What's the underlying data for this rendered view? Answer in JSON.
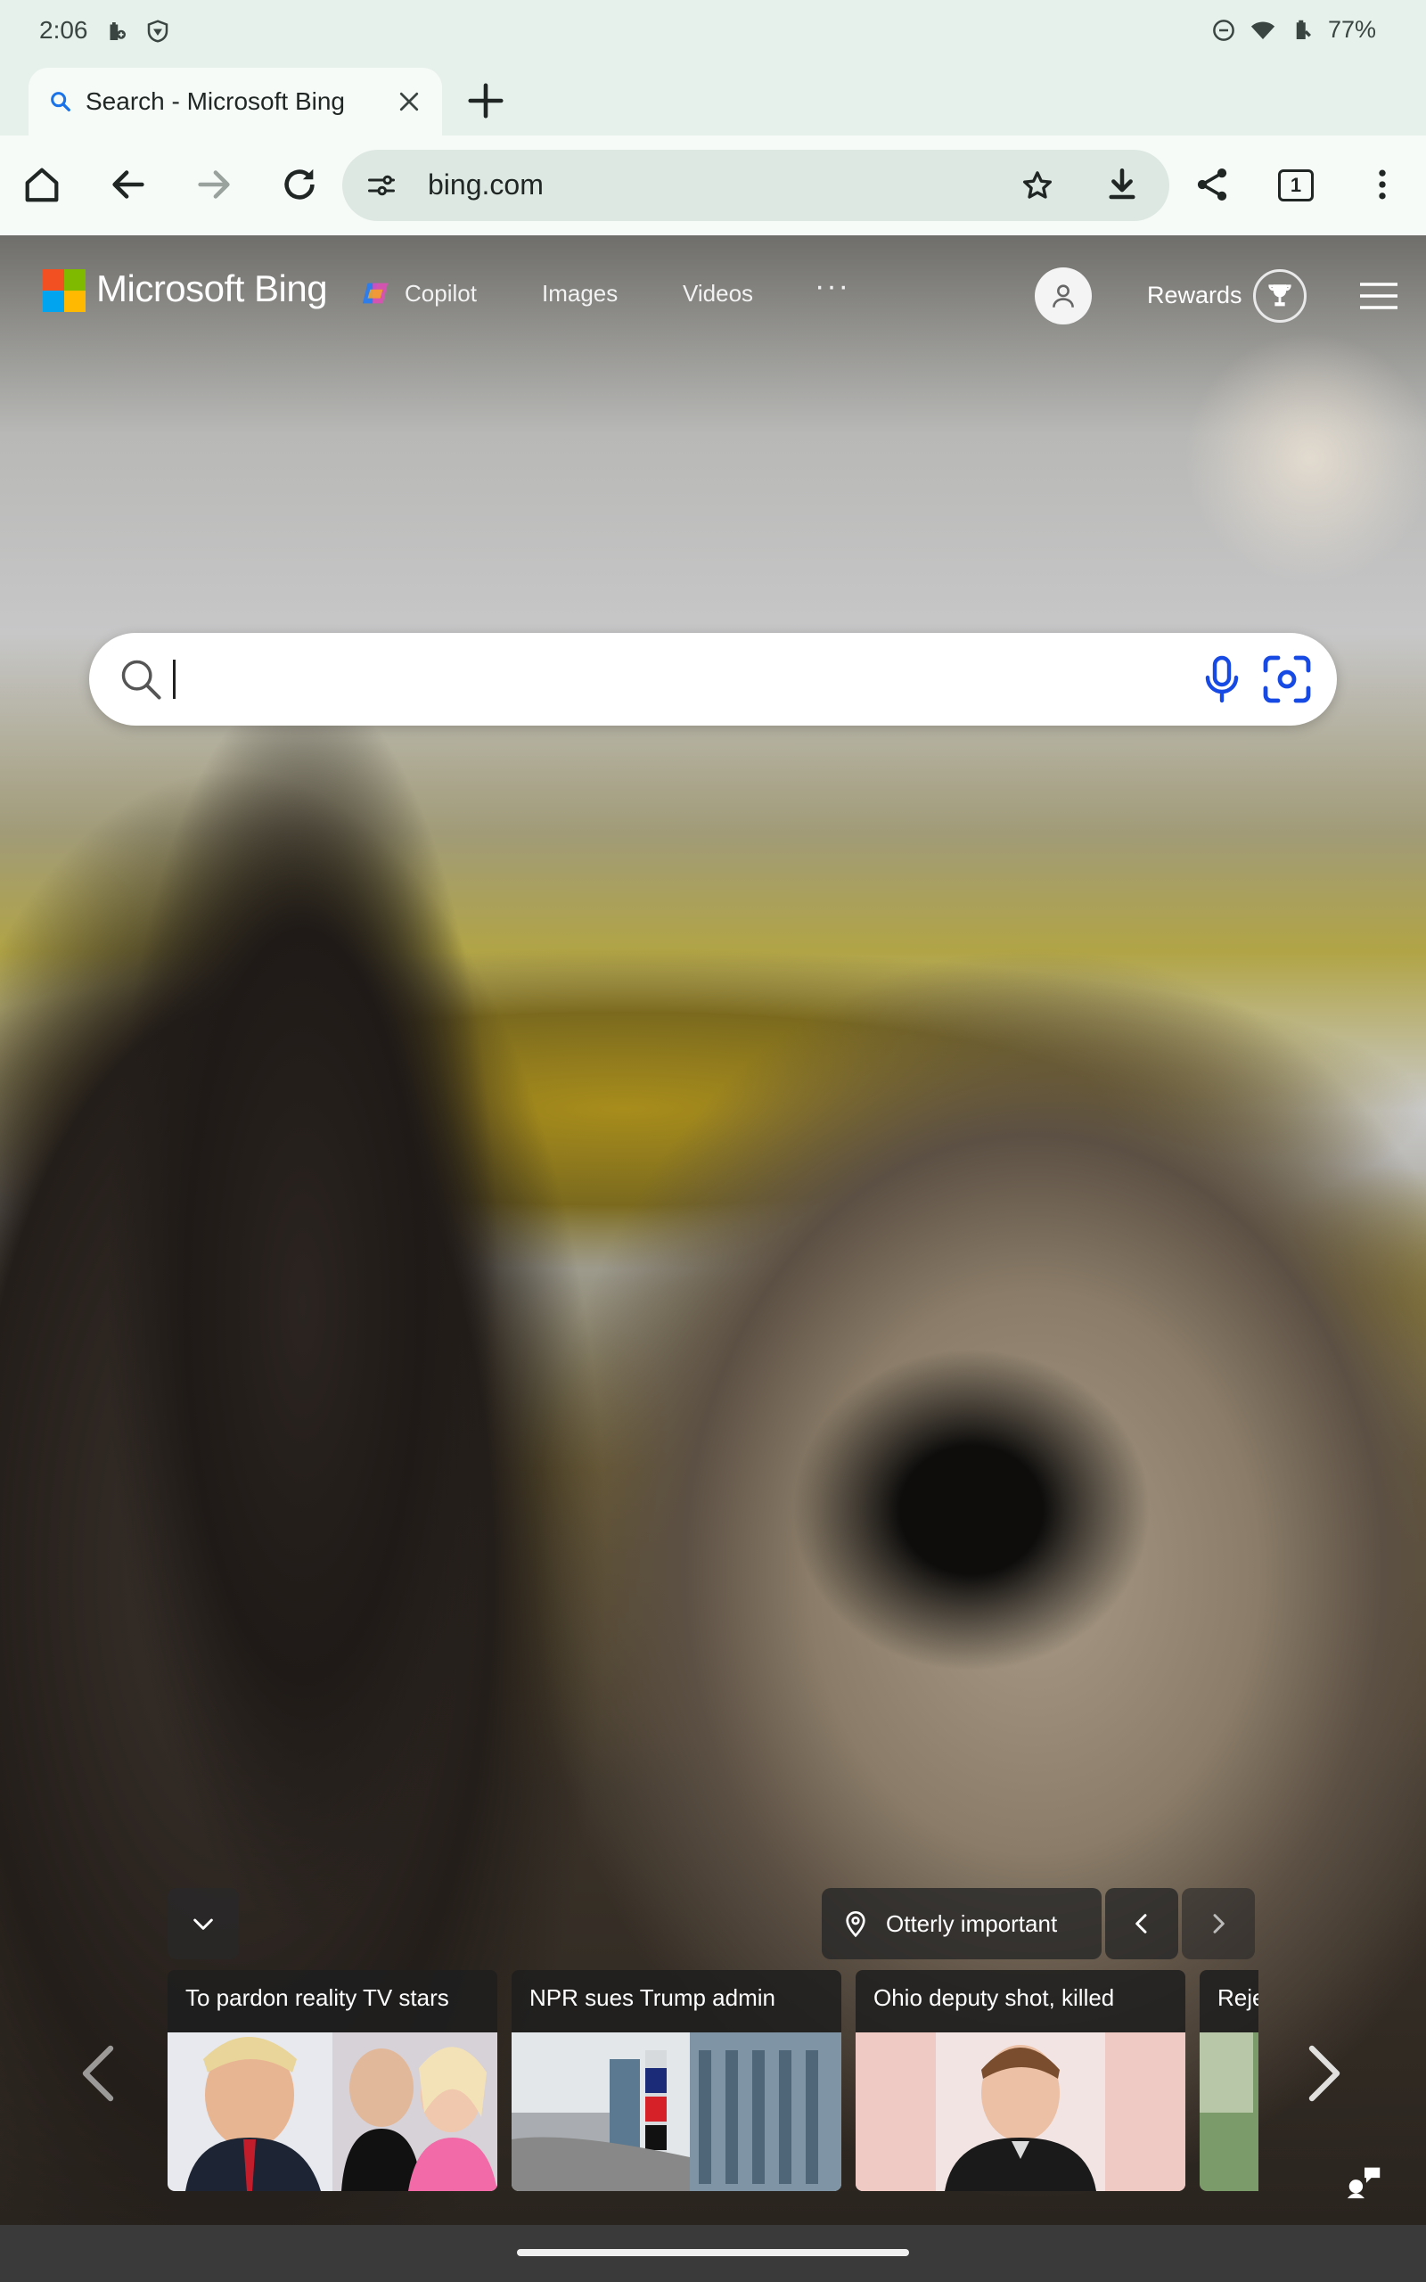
{
  "status_bar": {
    "time": "2:06",
    "battery": "77%"
  },
  "tab": {
    "title": "Search - Microsoft Bing"
  },
  "toolbar": {
    "url": "bing.com",
    "tabs_count": "1"
  },
  "bing": {
    "brand": "Microsoft Bing",
    "nav": {
      "copilot": "Copilot",
      "images": "Images",
      "videos": "Videos",
      "more": "···"
    },
    "rewards": "Rewards",
    "search": {
      "value": "",
      "placeholder": ""
    },
    "location_label": "Otterly important",
    "news": [
      {
        "title": "To pardon reality TV stars"
      },
      {
        "title": "NPR sues Trump admin"
      },
      {
        "title": "Ohio deputy shot, killed"
      },
      {
        "title": "Reje"
      }
    ]
  },
  "colors": {
    "ms_red": "#f25022",
    "ms_green": "#7fba00",
    "ms_blue": "#00a4ef",
    "ms_yellow": "#ffb900",
    "browser_bg": "#e7f1ec",
    "toolbar_bg": "#f6fbf8",
    "omnibox_bg": "#dde8e2",
    "bing_accent": "#174ae4"
  },
  "icons": {
    "status_left": [
      "battery-saver-icon",
      "vpn-shield-icon"
    ],
    "status_right": [
      "do-not-disturb-icon",
      "wifi-icon",
      "battery-icon"
    ],
    "toolbar": [
      "home-icon",
      "back-icon",
      "forward-icon",
      "reload-icon",
      "site-settings-icon",
      "star-icon",
      "download-icon",
      "share-icon",
      "tab-switcher-icon",
      "more-vert-icon"
    ],
    "bing": [
      "search-icon",
      "microphone-icon",
      "visual-search-icon",
      "location-pin-icon",
      "chevron-down-icon",
      "feedback-icon"
    ]
  }
}
